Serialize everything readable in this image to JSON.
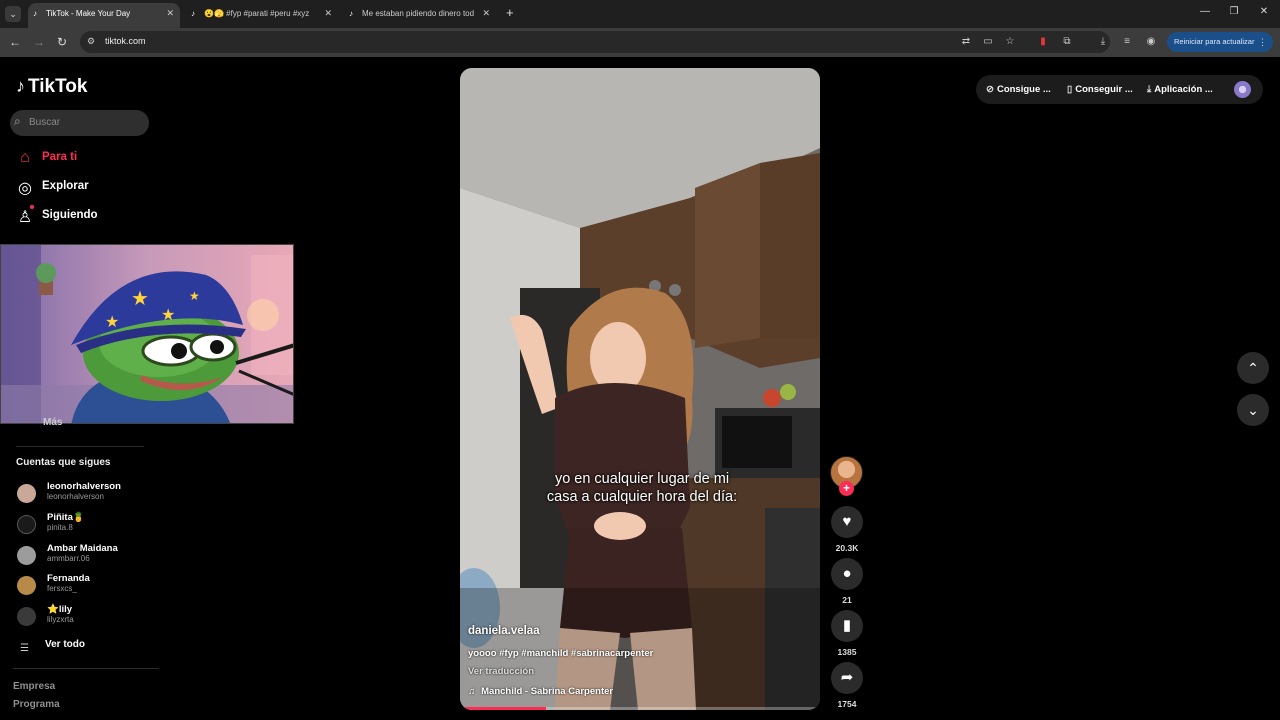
{
  "browser": {
    "tabs": [
      {
        "title": "TikTok - Make Your Day",
        "favicon": "♪"
      },
      {
        "title": "😮🫣 #fyp #parati #peru #xyz",
        "favicon": "♪"
      },
      {
        "title": "Me estaban pidiendo dinero tod",
        "favicon": "♪"
      }
    ],
    "url": "tiktok.com",
    "restart_label": "Reiniciar para actualizar"
  },
  "tiktok": {
    "logo_text": "TikTok",
    "search_placeholder": "Buscar",
    "nav": [
      {
        "label": "Para ti",
        "icon": "home-icon"
      },
      {
        "label": "Explorar",
        "icon": "compass-icon"
      },
      {
        "label": "Siguiendo",
        "icon": "user-follow-icon"
      }
    ],
    "more_label": "Más",
    "following_title": "Cuentas que sigues",
    "following": [
      {
        "name": "leonorhalverson",
        "handle": "leonorhalverson",
        "avatar_color": "#c9a89a"
      },
      {
        "name": "Piñita🍍",
        "handle": "pinita.8",
        "avatar_color": "#1a1a1a"
      },
      {
        "name": "Ambar Maidana",
        "handle": "ammbarr.06",
        "avatar_color": "#9c9c9c"
      },
      {
        "name": "Fernanda",
        "handle": "fersxcs_",
        "avatar_color": "#b88a4a"
      },
      {
        "name": "⭐lily",
        "handle": "lilyzxrta",
        "avatar_color": "#3a3a3a"
      }
    ],
    "see_all_label": "Ver todo",
    "footer": [
      "Empresa",
      "Programa"
    ],
    "top_actions": [
      "Consigue ...",
      "Conseguir ...",
      "Aplicación ..."
    ]
  },
  "video": {
    "caption": "yo en cualquier lugar de mi casa a cualquier hora del día:",
    "username": "daniela.velaa",
    "description": "yoooo #fyp #manchild #sabrinacarpenter",
    "translate_label": "Ver traducción",
    "music": "Manchild - Sabrina Carpenter",
    "progress": 0.24,
    "likes": "20.3K",
    "comments": "21",
    "saves": "1385",
    "shares": "1754"
  }
}
